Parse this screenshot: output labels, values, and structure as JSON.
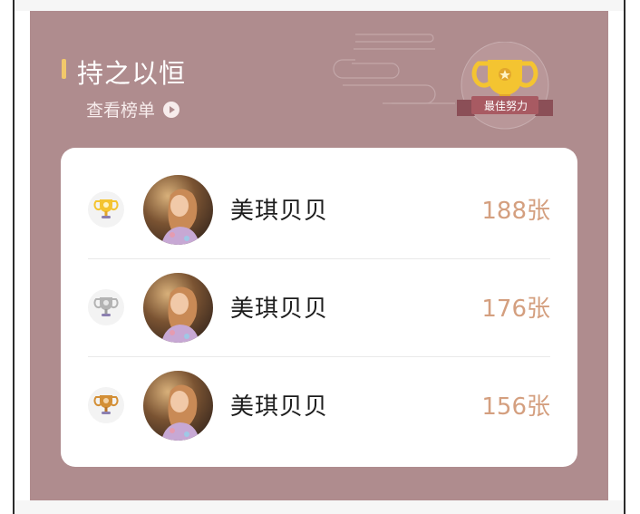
{
  "section": {
    "title": "持之以恒",
    "view_list_link": "查看榜单",
    "badge_text": "最佳努力",
    "colors": {
      "panel_bg": "#af8c8e",
      "accent_bar": "#f2c86a",
      "count_color": "#d49f7f",
      "trophy_gold": "#f4c431",
      "trophy_silver": "#b3b3b3",
      "trophy_bronze": "#d38f36"
    },
    "icons": [
      "play-icon",
      "trophy-badge-icon",
      "cloud-decoration"
    ]
  },
  "leaderboard": {
    "rows": [
      {
        "rank_icon": "gold-trophy-icon",
        "name": "美琪贝贝",
        "count": "188张"
      },
      {
        "rank_icon": "silver-trophy-icon",
        "name": "美琪贝贝",
        "count": "176张"
      },
      {
        "rank_icon": "bronze-trophy-icon",
        "name": "美琪贝贝",
        "count": "156张"
      }
    ]
  }
}
